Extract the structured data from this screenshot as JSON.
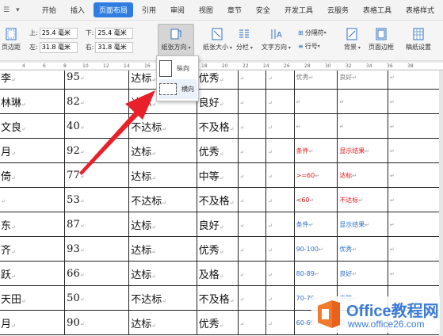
{
  "menubar": {
    "quick_access": [
      "☰",
      "▾"
    ],
    "tabs": [
      "开始",
      "插入",
      "页面布局",
      "引用",
      "审阅",
      "视图",
      "章节",
      "安全",
      "开发工具",
      "云服务",
      "表格工具",
      "表格样式"
    ],
    "active_tab": "页面布局"
  },
  "ribbon": {
    "page_margin": "页边距",
    "margins": {
      "top_label": "上:",
      "top_value": "25.4 毫米",
      "bottom_label": "下:",
      "bottom_value": "25.4 毫米",
      "left_label": "左:",
      "left_value": "31.8 毫米",
      "right_label": "右:",
      "right_value": "31.8 毫米"
    },
    "orientation": "纸张方向",
    "size": "纸张大小",
    "columns": "分栏",
    "text_direction": "文字方向",
    "separator": "分隔符",
    "line_number": "行号",
    "background": "背景",
    "page_border": "页面边框",
    "draft_settings": "稿纸设置"
  },
  "ruler_numbers": [
    "4",
    "6",
    "8",
    "10",
    "12",
    "14",
    "16",
    "18",
    "20",
    "22",
    "24",
    "26",
    "28",
    "30",
    "32",
    "34",
    "36",
    "38"
  ],
  "orientation_menu": {
    "portrait": "纵向",
    "landscape": "横向"
  },
  "table": {
    "rows": [
      [
        "李",
        "95",
        "达标",
        "优秀",
        "",
        "",
        "优秀",
        "良好",
        ""
      ],
      [
        "林琳",
        "82",
        "达标",
        "良好",
        "",
        "",
        "",
        "",
        ""
      ],
      [
        "文良",
        "40",
        "不达标",
        "不及格",
        "",
        "",
        "",
        "",
        ""
      ],
      [
        "月",
        "92",
        "达标",
        "优秀",
        "",
        "",
        "条件",
        "显示结果",
        ""
      ],
      [
        "倚",
        "77",
        "达标",
        "中等",
        "",
        "",
        ">=60",
        "达标",
        ""
      ],
      [
        "",
        "53",
        "不达标",
        "不及格",
        "",
        "",
        "<60",
        "不达标",
        ""
      ],
      [
        "东",
        "87",
        "达标",
        "良好",
        "",
        "",
        "条件",
        "显示结果",
        ""
      ],
      [
        "齐",
        "93",
        "达标",
        "优秀",
        "",
        "",
        "90-100",
        "优秀",
        ""
      ],
      [
        "跃",
        "66",
        "达标",
        "及格",
        "",
        "",
        "80-89",
        "良好",
        ""
      ],
      [
        "天田",
        "50",
        "不达标",
        "不及格",
        "",
        "",
        "70-79",
        "中等",
        ""
      ],
      [
        "月",
        "90",
        "达标",
        "优秀",
        "",
        "",
        "60-69",
        "及格",
        ""
      ]
    ]
  },
  "colors": {
    "accent": "#2f7de1",
    "red_text": "#e5171a",
    "blue_text": "#2e6fc8",
    "arrow": "#e8202a"
  },
  "watermark": {
    "title": "Office教程网",
    "url": "www.office26.com"
  }
}
